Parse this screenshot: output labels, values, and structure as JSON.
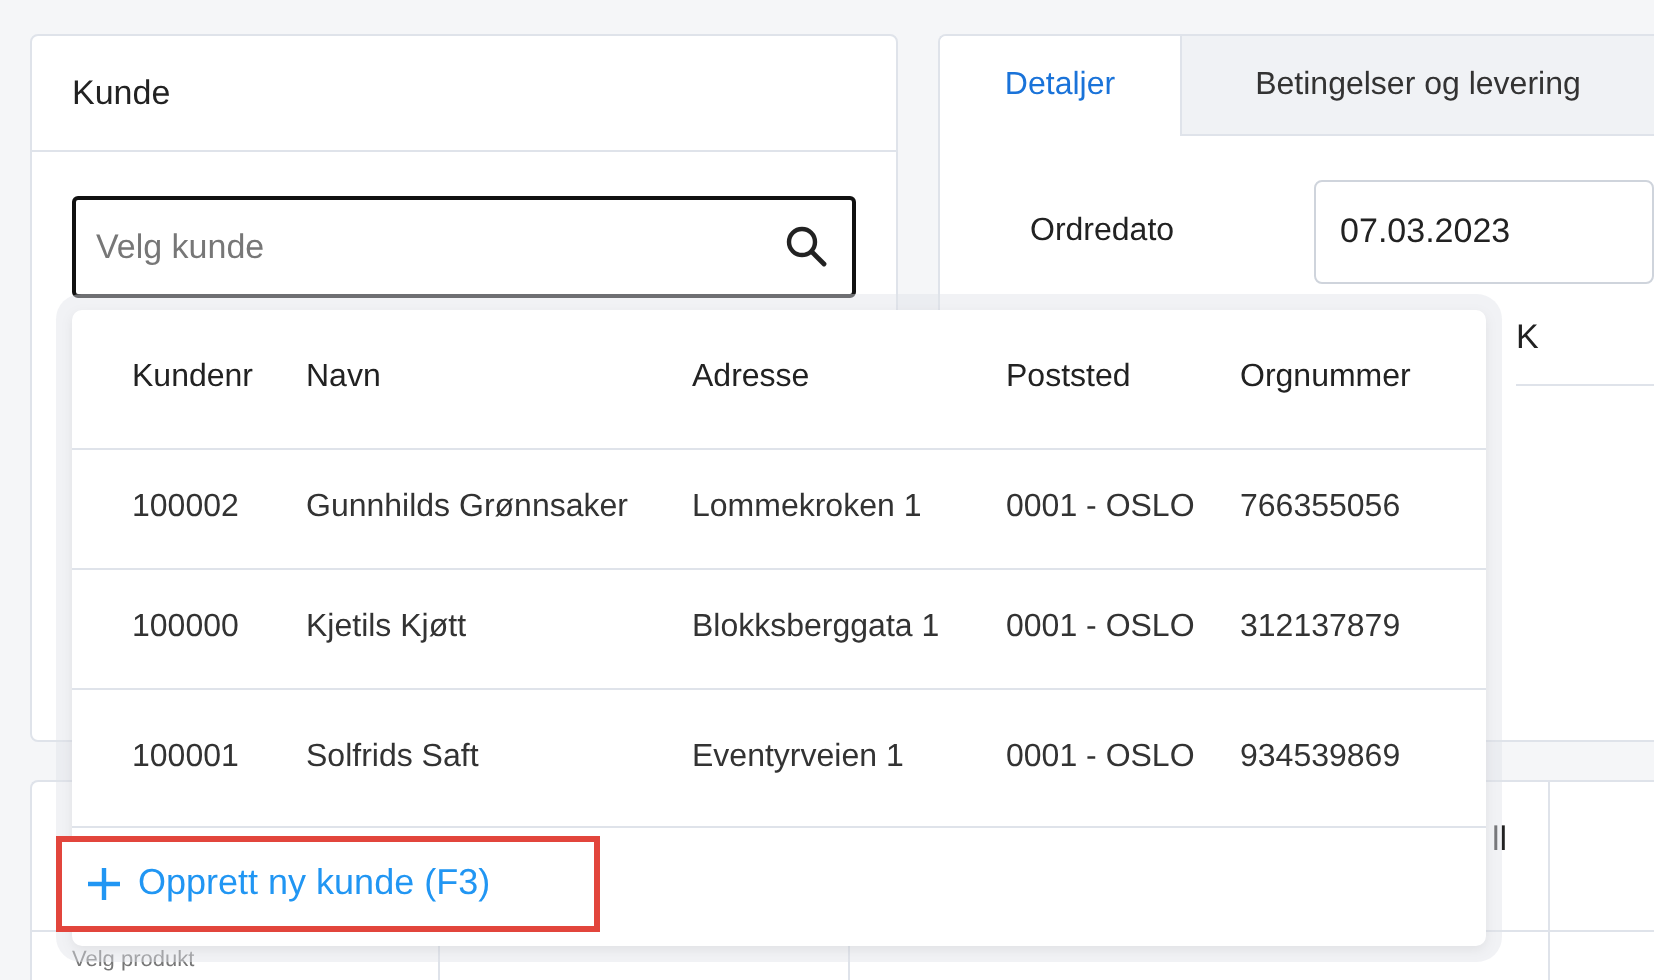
{
  "customer_card": {
    "title": "Kunde",
    "search": {
      "placeholder": "Velg kunde"
    }
  },
  "order_card": {
    "tabs": [
      {
        "label": "Detaljer",
        "selected": true
      },
      {
        "label": "Betingelser og levering",
        "selected": false
      }
    ],
    "fields": [
      {
        "label": "Ordredato",
        "value": "07.03.2023"
      }
    ],
    "partial_text": "K"
  },
  "product_card": {
    "partial_header": "ll",
    "product_placeholder": "Velg produkt"
  },
  "customer_dropdown": {
    "columns": [
      "Kundenr",
      "Navn",
      "Adresse",
      "Poststed",
      "Orgnummer"
    ],
    "rows": [
      [
        "100002",
        "Gunnhilds Grønnsaker",
        "Lommekroken 1",
        "0001 - OSLO",
        "766355056"
      ],
      [
        "100000",
        "Kjetils Kjøtt",
        "Blokksberggata 1",
        "0001 - OSLO",
        "312137879"
      ],
      [
        "100001",
        "Solfrids Saft",
        "Eventyrveien 1",
        "0001 - OSLO",
        "934539869"
      ]
    ],
    "create_button": {
      "label": "Opprett ny kunde (F3)",
      "highlighted": true
    }
  }
}
